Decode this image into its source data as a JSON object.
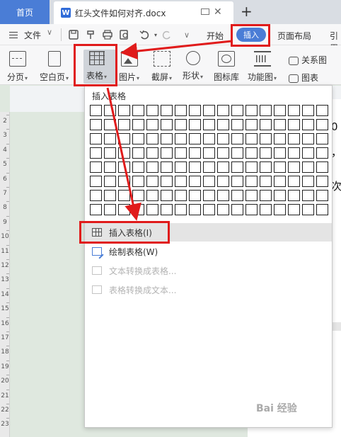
{
  "tabs": {
    "home": "首页",
    "doc_icon": "W",
    "doc_title": "红头文件如何对齐.docx",
    "close": "✕",
    "new_tab": "+"
  },
  "menubar": {
    "file": "文件",
    "chevron": "∨",
    "start": "开始",
    "insert": "插入",
    "page_layout": "页面布局",
    "reference": "引用"
  },
  "ribbon": {
    "page_break": "分页",
    "blank_page": "空白页",
    "table": "表格",
    "picture": "图片",
    "screenshot": "截屏",
    "shape": "形状",
    "icon_library": "图标库",
    "function_chart": "功能图",
    "relation_chart": "关系图",
    "chart": "图表"
  },
  "dropdown": {
    "title": "插入表格",
    "insert_table": "插入表格(I)",
    "draw_table": "绘制表格(W)",
    "text_to_table": "文本转换成表格...",
    "table_to_text": "表格转换成文本..."
  },
  "ruler_numbers": [
    "2",
    "3",
    "4",
    "5",
    "6",
    "7",
    "8",
    "9",
    "10",
    "11",
    "12",
    "13",
    "14",
    "15",
    "16",
    "17",
    "18",
    "19",
    "20",
    "21",
    "22",
    "23"
  ],
  "doc_text": {
    "line1": "0",
    "line2": "，",
    "line3": "次"
  },
  "watermark": "Bai 经验",
  "colors": {
    "accent": "#4a7dd6",
    "annotation": "#e01b1b",
    "menu_highlight": "#e4e4e4"
  }
}
